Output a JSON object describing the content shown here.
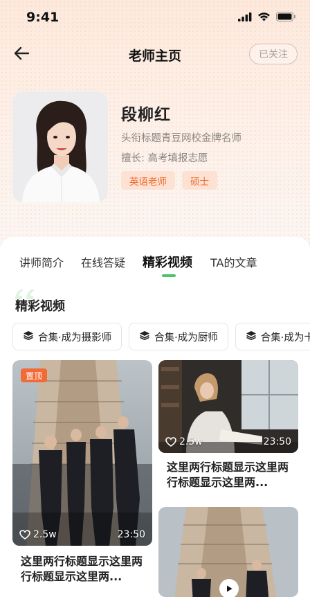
{
  "status_bar": {
    "time": "9:41"
  },
  "nav": {
    "title": "老师主页",
    "follow_label": "已关注"
  },
  "teacher": {
    "name": "段柳红",
    "title": "头衔标题青豆网校金牌名师",
    "skill": "擅长: 高考填报志愿",
    "tags": [
      "英语老师",
      "硕士"
    ]
  },
  "tabs": [
    {
      "label": "讲师简介",
      "active": false
    },
    {
      "label": "在线答疑",
      "active": false
    },
    {
      "label": "精彩视频",
      "active": true
    },
    {
      "label": "TA的文章",
      "active": false
    }
  ],
  "section": {
    "title": "精彩视频"
  },
  "collections": [
    {
      "label": "合集·成为摄影师"
    },
    {
      "label": "合集·成为厨师"
    },
    {
      "label": "合集·成为卡车司机"
    }
  ],
  "videos": [
    {
      "badge": "置顶",
      "likes": "2.5w",
      "duration": "23:50",
      "title": "这里两行标题显示这里两行标题显示这里两..."
    },
    {
      "likes": "2.5w",
      "duration": "23:50",
      "title": "这里两行标题显示这里两行标题显示这里两..."
    }
  ],
  "colors": {
    "accent": "#4fc36a",
    "tag_bg": "#fde2d3",
    "tag_text": "#f06d34",
    "pin_badge": "#f26a37"
  }
}
